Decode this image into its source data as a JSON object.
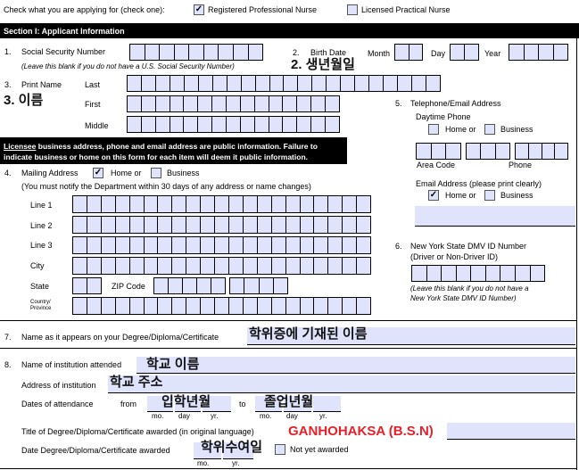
{
  "header": {
    "prompt": "Check what you are applying for (check one):",
    "rn_label": "Registered Professional Nurse",
    "rn_checked": "✓",
    "lpn_label": "Licensed Practical Nurse"
  },
  "section_title": "Section I: Applicant Information",
  "ssn": {
    "num": "1.",
    "label": "Social Security Number",
    "note": "(Leave this blank if you do not have a U.S. Social Security Number)"
  },
  "birth": {
    "num": "2.",
    "label": "Birth Date",
    "month": "Month",
    "day": "Day",
    "year": "Year",
    "annotation": "2. 생년월일"
  },
  "name": {
    "num": "3.",
    "label": "Print Name",
    "last": "Last",
    "first": "First",
    "middle": "Middle",
    "annotation": "3. 이름"
  },
  "notice": {
    "underlined": "Licensee",
    "line1": " business address, phone and email address are public information. Failure to",
    "line2": "indicate business or home on this form for each item will deem it public information."
  },
  "mailing": {
    "num": "4.",
    "label": "Mailing Address",
    "home_checked": "✓",
    "home": "Home or",
    "business": "Business",
    "note": "(You must notify the Department within 30 days of any address or name changes)",
    "line1": "Line 1",
    "line2": "Line 2",
    "line3": "Line 3",
    "city": "City",
    "state": "State",
    "zip": "ZIP Code",
    "country": "Country/",
    "province": "Province"
  },
  "phone": {
    "num": "5.",
    "label": "Telephone/Email Address",
    "daytime": "Daytime Phone",
    "home": "Home or",
    "business": "Business",
    "area_code": "Area Code",
    "phone": "Phone"
  },
  "email": {
    "label": "Email Address (please print clearly)",
    "home_checked": "✓",
    "home": "Home or",
    "business": "Business"
  },
  "dmv": {
    "num": "6.",
    "label": "New York State DMV ID Number",
    "sublabel": "(Driver or Non-Driver ID)",
    "note1": "(Leave this blank if you do not have a",
    "note2": "New York State DMV ID Number)"
  },
  "degree_name": {
    "num": "7.",
    "label": "Name as it appears on your Degree/Diploma/Certificate",
    "value": "학위증에 기재된 이름"
  },
  "institution": {
    "num": "8.",
    "name_label": "Name of institution attended",
    "name_value": "학교 이름",
    "address_label": "Address of institution",
    "address_value": "학교 주소",
    "dates_label": "Dates of attendance",
    "from": "from",
    "to": "to",
    "from_value": "입학년월",
    "to_value": "졸업년월",
    "mo": "mo.",
    "day": "day",
    "yr": "yr.",
    "title_label": "Title of Degree/Diploma/Certificate awarded (in original language)",
    "title_value": "GANHOHAKSA (B.S.N)",
    "date_label": "Date Degree/Diploma/Certificate awarded",
    "date_value": "학위수여일",
    "not_yet": "Not yet awarded"
  }
}
